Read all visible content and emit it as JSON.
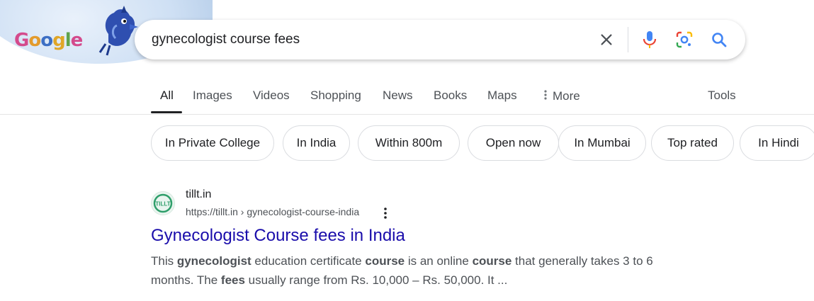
{
  "doodle": {
    "letters": [
      "G",
      "o",
      "o",
      "g",
      "l",
      "e"
    ],
    "letter_colors": [
      "#d44a8c",
      "#e39b2d",
      "#3d6fc4",
      "#e0a628",
      "#5fa34c",
      "#d44a8c"
    ]
  },
  "search": {
    "query": "gynecologist course fees"
  },
  "icons": {
    "clear": "close-icon",
    "mic": "mic-icon",
    "lens": "lens-icon",
    "search": "search-icon",
    "more": "more-vert-icon"
  },
  "tabs": [
    {
      "label": "All",
      "active": true
    },
    {
      "label": "Images"
    },
    {
      "label": "Videos"
    },
    {
      "label": "Shopping"
    },
    {
      "label": "News"
    },
    {
      "label": "Books"
    },
    {
      "label": "Maps"
    },
    {
      "label": "More"
    }
  ],
  "tools_label": "Tools",
  "chips": [
    "In Private College",
    "In India",
    "Within 800m",
    "Open now",
    "In Mumbai",
    "Top rated",
    "In Hindi"
  ],
  "result": {
    "site_name": "tillt.in",
    "url": "https://tillt.in › gynecologist-course-india",
    "favicon_text": "TILLT",
    "title": "Gynecologist Course fees in India",
    "snippet": {
      "line1": [
        {
          "t": "This ",
          "b": false
        },
        {
          "t": "gynecologist",
          "b": true
        },
        {
          "t": " education certificate ",
          "b": false
        },
        {
          "t": "course",
          "b": true
        },
        {
          "t": " is an online ",
          "b": false
        },
        {
          "t": "course",
          "b": true
        },
        {
          "t": " that generally takes 3 to 6",
          "b": false
        }
      ],
      "line2": [
        {
          "t": "months. The ",
          "b": false
        },
        {
          "t": "fees",
          "b": true
        },
        {
          "t": " usually range from Rs. 10,000 – Rs. 50,000. It ...",
          "b": false
        }
      ]
    }
  },
  "colors": {
    "link": "#1a0dab",
    "text": "#202124",
    "muted": "#4d5156",
    "google_blue": "#4285f4",
    "google_red": "#ea4335",
    "google_yellow": "#fbbc04",
    "google_green": "#34a853"
  }
}
